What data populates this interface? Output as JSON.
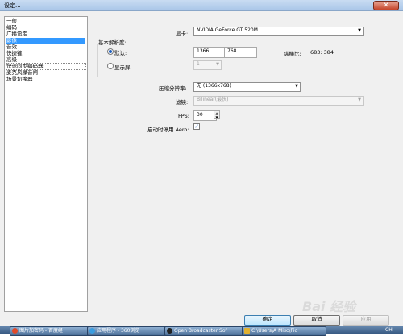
{
  "window": {
    "title": "设定...",
    "close_glyph": "✕"
  },
  "sidebar": {
    "items": [
      {
        "label": "一般"
      },
      {
        "label": "编码"
      },
      {
        "label": "广播设定"
      },
      {
        "label": "影像",
        "selected": true
      },
      {
        "label": "音效"
      },
      {
        "label": "快捷键"
      },
      {
        "label": "高级"
      },
      {
        "label": "快速同步编码器"
      },
      {
        "label": "麦克风噪音闸"
      },
      {
        "label": "场景切换器"
      }
    ]
  },
  "video": {
    "adapter_label": "显卡:",
    "adapter_value": "NVIDIA GeForce GT 520M",
    "base_res_title": "基本解析度:",
    "default_label": "默认:",
    "width": "1366",
    "height": "768",
    "aspect_label": "纵横比:",
    "aspect_value": "683: 384",
    "monitor_label": "显示屏:",
    "monitor_value": "1",
    "downscale_label": "压缩分辨率:",
    "downscale_value": "无 (1366x768)",
    "filter_label": "滤镜:",
    "filter_value": "Bilinear(最快)",
    "fps_label": "FPS:",
    "fps_value": "30",
    "aero_label": "启动时停用 Aero:",
    "aero_checked": true
  },
  "buttons": {
    "ok": "确定",
    "cancel": "取消",
    "apply": "应用"
  },
  "taskbar": {
    "items": [
      {
        "label": "图片加密码 - 百度经",
        "color": "#e04a2a"
      },
      {
        "label": "应用程序 - 360浏览",
        "color": "#3a9de0"
      },
      {
        "label": "Open Broadcaster Sof",
        "color": "#222222"
      },
      {
        "label": "C:\\Users\\A Misc\\Pic",
        "color": "#e0b030"
      }
    ],
    "tray_text": "CH"
  },
  "watermark": "Bai 经验"
}
